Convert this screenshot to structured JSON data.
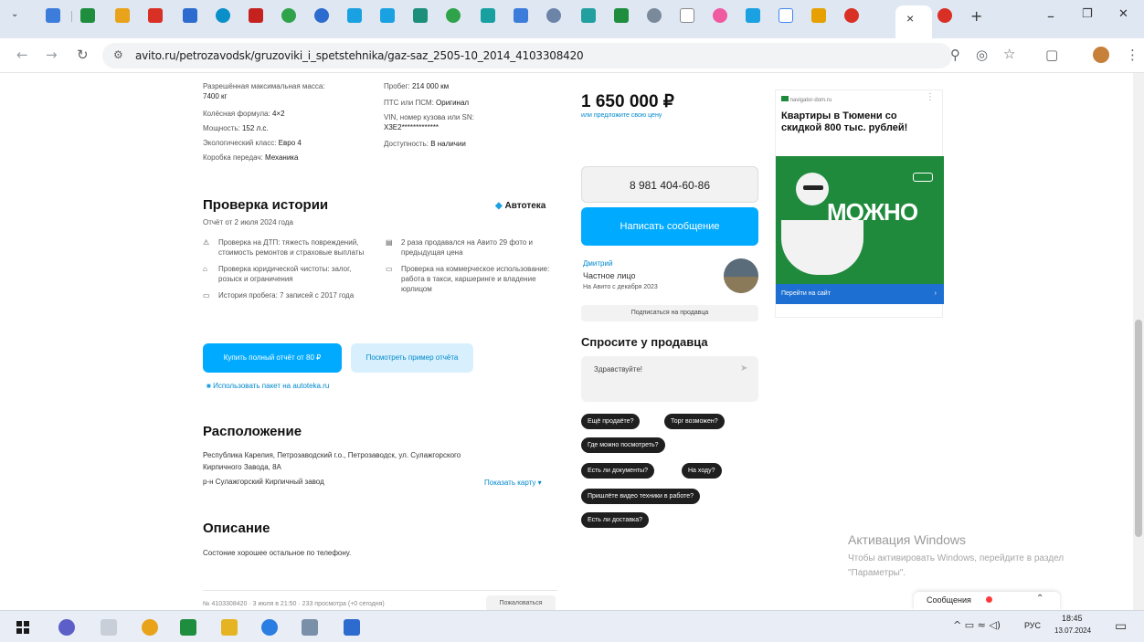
{
  "browser": {
    "url": "avito.ru/petrozavodsk/gruzoviki_i_spetstehnika/gaz-saz_2505-10_2014_4103308420",
    "close_tab": "×",
    "new_tab": "+",
    "minimize": "–",
    "restore": "❐",
    "close": "✕"
  },
  "specs_left": [
    {
      "label": "Разрешённая максимальная масса:",
      "value": "7400 кг"
    },
    {
      "label": "Колёсная формула:",
      "value": "4×2"
    },
    {
      "label": "Мощность:",
      "value": "152 л.с."
    },
    {
      "label": "Экологический класс:",
      "value": "Евро 4"
    },
    {
      "label": "Коробка передач:",
      "value": "Механика"
    }
  ],
  "specs_right": [
    {
      "label": "Пробег:",
      "value": "214 000 км"
    },
    {
      "label": "ПТС или ПСМ:",
      "value": "Оригинал"
    },
    {
      "label": "VIN, номер кузова или SN:",
      "value": "X3E2*************"
    },
    {
      "label": "Доступность:",
      "value": "В наличии"
    }
  ],
  "history": {
    "title": "Проверка истории",
    "date": "Отчёт от 2 июля 2024 года",
    "brand": "Автотека",
    "items_left": [
      "Проверка на ДТП: тяжесть повреждений, стоимость ремонтов и страховые выплаты",
      "Проверка юридической чистоты: залог, розыск и ограничения",
      "История пробега: 7 записей с 2017 года"
    ],
    "items_right": [
      "2 раза продавался на Авито 29 фото и предыдущая цена",
      "Проверка на коммерческое использование: работа в такси, каршеринге и владение юрлицом"
    ],
    "buy_btn": "Купить полный отчёт от 80 ₽",
    "example_btn": "Посмотреть пример отчёта",
    "package_link": "Использовать пакет на autoteka.ru"
  },
  "location": {
    "title": "Расположение",
    "address": "Республика Карелия, Петрозаводский г.о., Петрозаводск, ул. Сулажгорского Кирпичного Завода, 8А",
    "district": "р-н Сулажгорский Кирпичный завод",
    "map_link": "Показать карту ▾"
  },
  "description": {
    "title": "Описание",
    "text": "Состоние хорошее остальное по телефону."
  },
  "footer": {
    "meta": "№ 4103308420 · 3 июля в 21:50 · 233 просмотра (+0 сегодня)",
    "complain": "Пожаловаться"
  },
  "seller": {
    "price": "1 650 000 ₽",
    "offer_link": "или предложите свою цену",
    "phone": "8 981 404-60-86",
    "message_btn": "Написать сообщение",
    "name": "Дмитрий",
    "type": "Частное лицо",
    "since": "На Авито с декабря 2023",
    "subscribe": "Подписаться на продавца"
  },
  "ask": {
    "title": "Спросите у продавца",
    "placeholder": "Здравствуйте!",
    "chips": [
      "Ещё продаёте?",
      "Торг возможен?",
      "Где можно посмотреть?",
      "Есть ли документы?",
      "На ходу?",
      "Пришлёте видео техники в работе?",
      "Есть ли доставка?"
    ]
  },
  "ad": {
    "source": "navigator-dom.ru",
    "headline": "Квартиры в Тюмени со скидкой 800 тыс. рублей!",
    "big": "МОЖНО",
    "cta": "Перейти на сайт"
  },
  "windows": {
    "activation_title": "Активация Windows",
    "activation_text": "Чтобы активировать Windows, перейдите в раздел \"Параметры\".",
    "messages": "Сообщения",
    "lang": "РУС",
    "time": "18:45",
    "date": "13.07.2024"
  },
  "colors": {
    "accent": "#00aaff",
    "ad_green": "#1f8a3c",
    "tabbar": "#dfe7f3"
  }
}
